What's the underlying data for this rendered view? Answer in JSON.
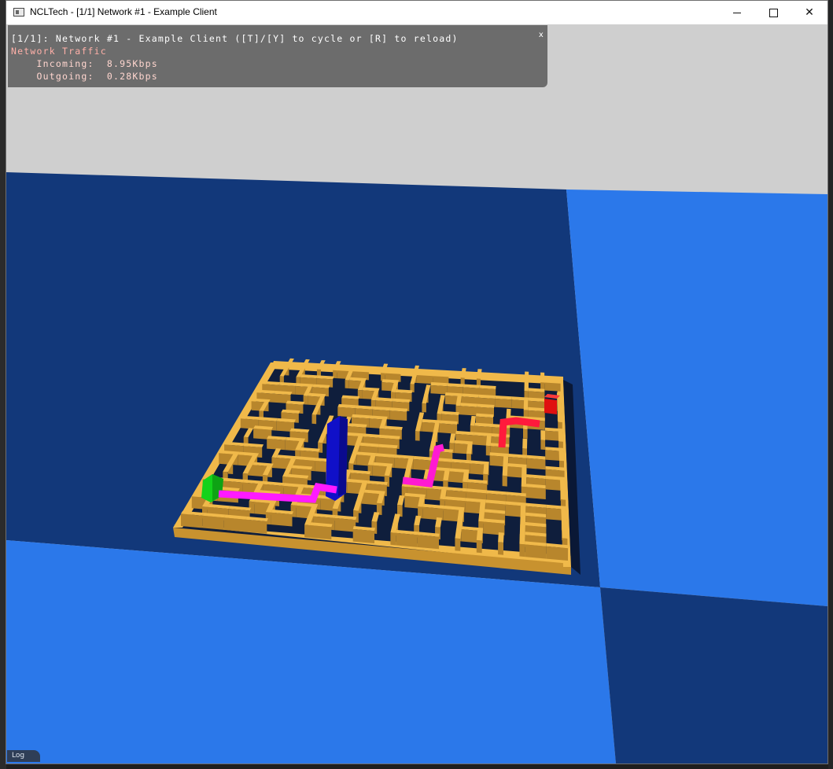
{
  "window": {
    "title": "NCLTech - [1/1] Network #1 - Example Client",
    "minimize_glyph": "minimize-icon",
    "maximize_glyph": "maximize-icon",
    "close_label": "✕"
  },
  "overlay": {
    "title": "[1/1]: Network #1 - Example Client ([T]/[Y] to cycle or [R] to reload)",
    "heading": "Network Traffic",
    "incoming": "    Incoming:  8.95Kbps",
    "outgoing": "    Outgoing:  0.28Kbps",
    "close": "x"
  },
  "log_tab": {
    "label": "Log"
  },
  "colors": {
    "sky": "#cfcfcf",
    "floor_dark": "#12387a",
    "floor_light": "#2b78ea",
    "maze_wall": "#f0b94a",
    "maze_wall_shade": "#b8862c",
    "maze_floor": "#0f1e3c",
    "player_blue": "#1010c8",
    "start_green": "#14d21a",
    "goal_red": "#e01010",
    "path_magenta": "#ff1aff",
    "path_red": "#ff1a3c"
  }
}
